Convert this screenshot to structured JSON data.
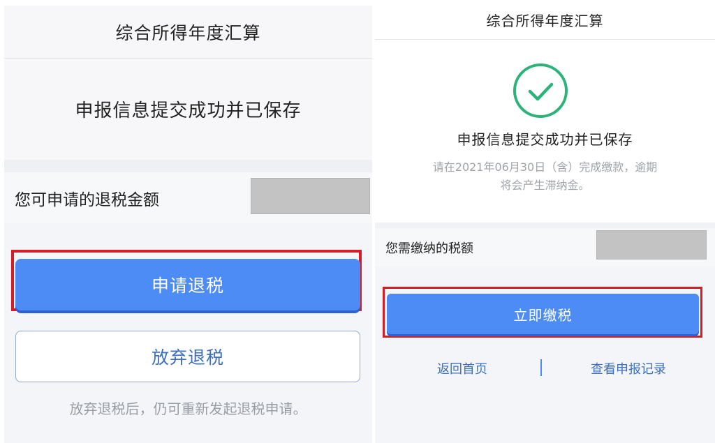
{
  "left_panel": {
    "header_title": "综合所得年度汇算",
    "status_message": "申报信息提交成功并已保存",
    "refund_label": "您可申请的退税金额",
    "apply_refund_button": "申请退税",
    "abandon_refund_button": "放弃退税",
    "note": "放弃退税后，仍可重新发起退税申请。"
  },
  "right_panel": {
    "header_title": "综合所得年度汇算",
    "status_icon": "check-circle-icon",
    "status_message": "申报信息提交成功并已保存",
    "payment_notice_line1": "请在2021年06月30日（含）完成缴款，逾期",
    "payment_notice_line2": "将会产生滞纳金。",
    "tax_label": "您需缴纳的税额",
    "pay_now_button": "立即缴税",
    "link_home": "返回首页",
    "link_records": "查看申报记录"
  },
  "colors": {
    "primary_button": "#4d8bf5",
    "highlight_frame": "#d51d25",
    "success_green": "#2db37a",
    "link_blue": "#3d6fbf",
    "redacted_amount": "#c3c3c3"
  }
}
